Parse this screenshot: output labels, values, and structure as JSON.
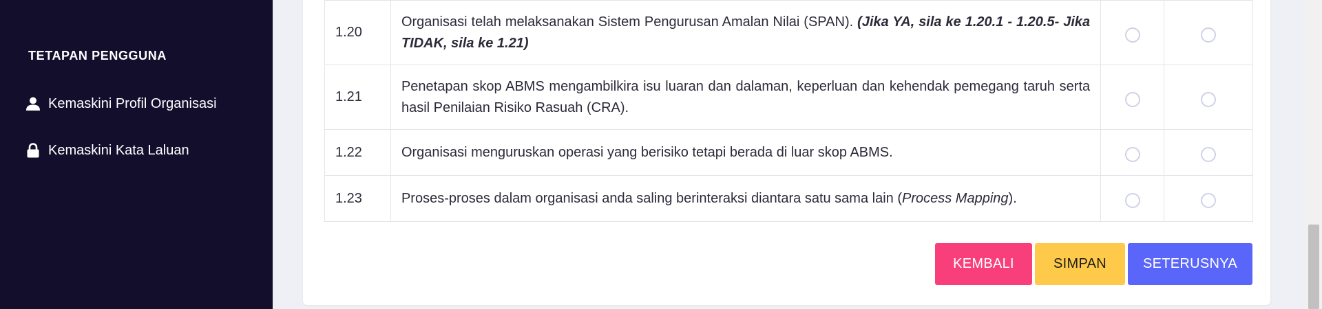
{
  "sidebar": {
    "heading": "TETAPAN PENGGUNA",
    "items": [
      {
        "label": "Kemaskini Profil Organisasi",
        "icon": "user-icon"
      },
      {
        "label": "Kemaskini Kata Laluan",
        "icon": "lock-icon"
      }
    ]
  },
  "table": {
    "rows": [
      {
        "num": "1.20",
        "text": "Organisasi telah melaksanakan Sistem Pengurusan Amalan Nilai (SPAN).",
        "note": "(Jika YA, sila ke 1.20.1 - 1.20.5- Jika TIDAK, sila ke 1.21)"
      },
      {
        "num": "1.21",
        "text": "Penetapan skop ABMS mengambilkira isu luaran dan dalaman, keperluan dan kehendak pemegang taruh serta hasil Penilaian Risiko Rasuah (CRA)."
      },
      {
        "num": "1.22",
        "text": "Organisasi menguruskan operasi yang berisiko tetapi berada di luar skop ABMS."
      },
      {
        "num": "1.23",
        "text_before": "Proses-proses dalam organisasi anda saling berinteraksi diantara satu sama lain (",
        "text_italic": "Process Mapping",
        "text_after": ")."
      }
    ]
  },
  "buttons": {
    "back": "KEMBALI",
    "save": "SIMPAN",
    "next": "SETERUSNYA"
  },
  "colors": {
    "sidebar_bg": "#120e2c",
    "back_button": "#f83f7c",
    "save_button": "#ffc94a",
    "next_button": "#5966f9"
  }
}
